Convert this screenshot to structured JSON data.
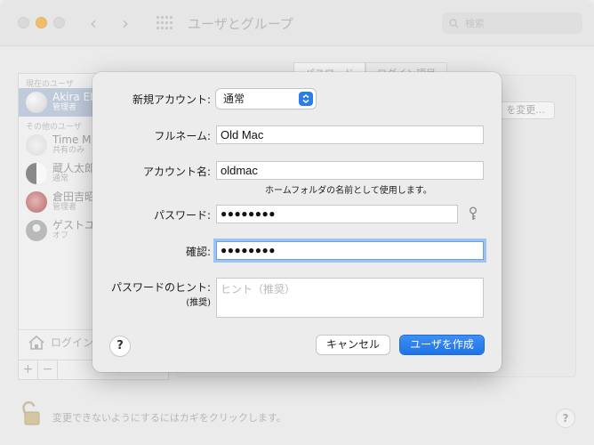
{
  "window": {
    "title": "ユーザとグループ",
    "search_placeholder": "検索"
  },
  "user_list": {
    "current_section": "現在のユーザ",
    "other_section": "その他のユーザ",
    "users": [
      {
        "name": "Akira Eb",
        "role": "管理者",
        "selected": true
      },
      {
        "name": "Time M",
        "role": "共有のみ"
      },
      {
        "name": "蔵人太郎",
        "role": "通常"
      },
      {
        "name": "倉田吉昭",
        "role": "管理者"
      },
      {
        "name": "ゲストユ",
        "role": "オフ"
      }
    ],
    "login_options": "ログイン",
    "add_label": "+",
    "remove_label": "−"
  },
  "background": {
    "tab_password": "パスワード",
    "tab_login": "ログイン項目",
    "change_button": "を変更..."
  },
  "footer": {
    "lock_text": "変更できないようにするにはカギをクリックします。",
    "help": "?"
  },
  "dialog": {
    "new_account_label": "新規アカウント:",
    "new_account_value": "通常",
    "full_name_label": "フルネーム:",
    "full_name_value": "Old Mac",
    "account_name_label": "アカウント名:",
    "account_name_value": "oldmac",
    "account_name_hint": "ホームフォルダの名前として使用します。",
    "password_label": "パスワード:",
    "password_value": "●●●●●●●●",
    "verify_label": "確認:",
    "verify_value": "●●●●●●●●",
    "hint_label": "パスワードのヒント:",
    "hint_sublabel": "(推奨)",
    "hint_placeholder": "ヒント（推奨）",
    "help": "?",
    "cancel_button": "キャンセル",
    "create_button": "ユーザを作成",
    "accent_color": "#2b7de9"
  }
}
